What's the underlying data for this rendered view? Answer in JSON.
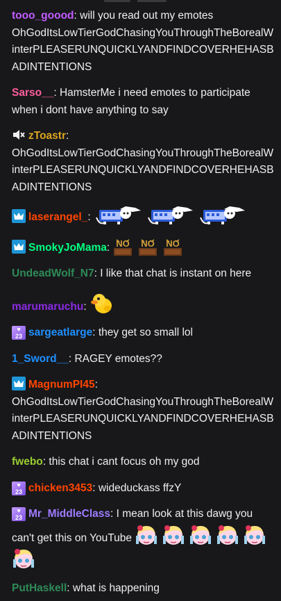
{
  "colors": {
    "background": "#18181b",
    "text": "#efeff1",
    "prime_badge": "#1e95d6"
  },
  "messages": [
    {
      "user": "tooo_goood",
      "color": "#c25cff",
      "text": "will you read out my emotes OhGodItsLowTierGodChasingYouThroughTheBorealWinterPLEASERUNQUICKLYANDFINDCOVERHEHASBADINTENTIONS"
    },
    {
      "user": "Sarso__",
      "color": "#ff5f9e",
      "text": "HamsterMe i need emotes to participate when i dont have anything to say"
    },
    {
      "user": "zToastr",
      "color": "#daa520",
      "badge": "muted-speaker-icon",
      "text": "OhGodItsLowTierGodChasingYouThroughTheBorealWinterPLEASERUNQUICKLYANDFINDCOVERHEHASBADINTENTIONS"
    },
    {
      "user": "laserangel_",
      "color": "#ff4500",
      "badge": "prime-crown-icon",
      "emotes": [
        "nyan-cat-emote",
        "nyan-cat-emote",
        "nyan-cat-emote"
      ]
    },
    {
      "user": "SmokyJoMama",
      "color": "#00ff7f",
      "badge": "prime-crown-icon",
      "emotes": [
        "no-sign-emote",
        "no-sign-emote",
        "no-sign-emote"
      ]
    },
    {
      "user": "UndeadWolf_N7",
      "color": "#2e8b57",
      "text": "I like that chat is instant on here"
    },
    {
      "user": "marumaruchu",
      "color": "#8a2be2",
      "emotes": [
        "yellow-duck-emote"
      ]
    },
    {
      "user": "sargeatlarge",
      "color": "#1e90ff",
      "badge": "2023-badge",
      "badge_label": "23",
      "text": "they get so small lol"
    },
    {
      "user": "1_Sword__",
      "color": "#1e90ff",
      "text": "RAGEY emotes??"
    },
    {
      "user": "MagnumPI45",
      "color": "#ff4500",
      "badge": "prime-crown-icon",
      "text": "OhGodItsLowTierGodChasingYouThroughTheBorealWinterPLEASERUNQUICKLYANDFINDCOVERHEHASBADINTENTIONS"
    },
    {
      "user": "fwebo",
      "color": "#9acd32",
      "text": "this chat i cant focus oh my god"
    },
    {
      "user": "chicken3453",
      "color": "#ff4500",
      "badge": "2023-badge",
      "badge_label": "23",
      "text": "wideduckass ffzY"
    },
    {
      "user": "Mr_MiddleClass",
      "color": "#9e7cff",
      "badge": "2023-badge",
      "badge_label": "23",
      "text": "I mean look at this dawg you can't get this on YouTube",
      "emotes": [
        "anime-girl-emote",
        "anime-girl-emote",
        "anime-girl-emote",
        "anime-girl-emote",
        "anime-girl-emote",
        "anime-girl-emote"
      ]
    },
    {
      "user": "PutHaskell",
      "color": "#2e8b57",
      "text": "what is happening"
    }
  ]
}
